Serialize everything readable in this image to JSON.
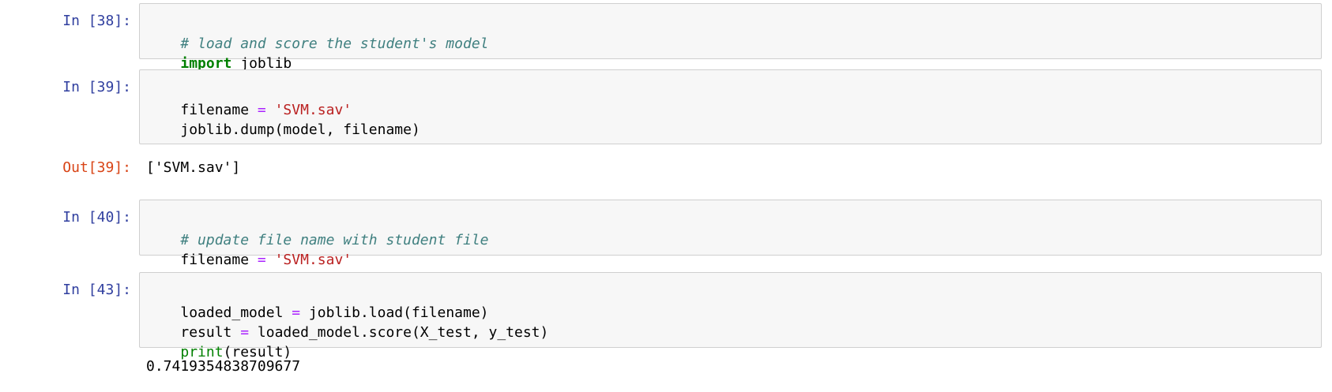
{
  "notebook": {
    "colors": {
      "input_prompt": "#303f9f",
      "output_prompt": "#d84315",
      "cell_background": "#f7f7f7",
      "cell_border": "#cfcfcf",
      "comment": "#408080",
      "keyword": "#008000",
      "string": "#ba2121",
      "operator": "#aa22ff",
      "builtin": "#008000"
    },
    "cells": [
      {
        "prompt": "In [38]:",
        "lines": [
          [
            {
              "t": "# load and score the student's model",
              "c": "cm"
            }
          ],
          [
            {
              "t": "import",
              "c": "kw"
            },
            {
              "t": " joblib",
              "c": "tx"
            }
          ]
        ]
      },
      {
        "prompt": "In [39]:",
        "lines": [
          [
            {
              "t": "filename ",
              "c": "tx"
            },
            {
              "t": "=",
              "c": "op"
            },
            {
              "t": " ",
              "c": "tx"
            },
            {
              "t": "'SVM.sav'",
              "c": "str"
            }
          ],
          [
            {
              "t": "joblib.dump(model, filename)",
              "c": "tx"
            }
          ]
        ],
        "output_prompt": "Out[39]:",
        "output": "['SVM.sav']"
      },
      {
        "prompt": "In [40]:",
        "lines": [
          [
            {
              "t": "# update file name with student file",
              "c": "cm"
            }
          ],
          [
            {
              "t": "filename ",
              "c": "tx"
            },
            {
              "t": "=",
              "c": "op"
            },
            {
              "t": " ",
              "c": "tx"
            },
            {
              "t": "'SVM.sav'",
              "c": "str"
            }
          ]
        ]
      },
      {
        "prompt": "In [43]:",
        "lines": [
          [
            {
              "t": "loaded_model ",
              "c": "tx"
            },
            {
              "t": "=",
              "c": "op"
            },
            {
              "t": " joblib.load(filename)",
              "c": "tx"
            }
          ],
          [
            {
              "t": "result ",
              "c": "tx"
            },
            {
              "t": "=",
              "c": "op"
            },
            {
              "t": " loaded_model.score(X_test, y_test)",
              "c": "tx"
            }
          ],
          [
            {
              "t": "print",
              "c": "bi"
            },
            {
              "t": "(result)",
              "c": "tx"
            }
          ]
        ],
        "stream_output": "0.7419354838709677"
      }
    ]
  }
}
